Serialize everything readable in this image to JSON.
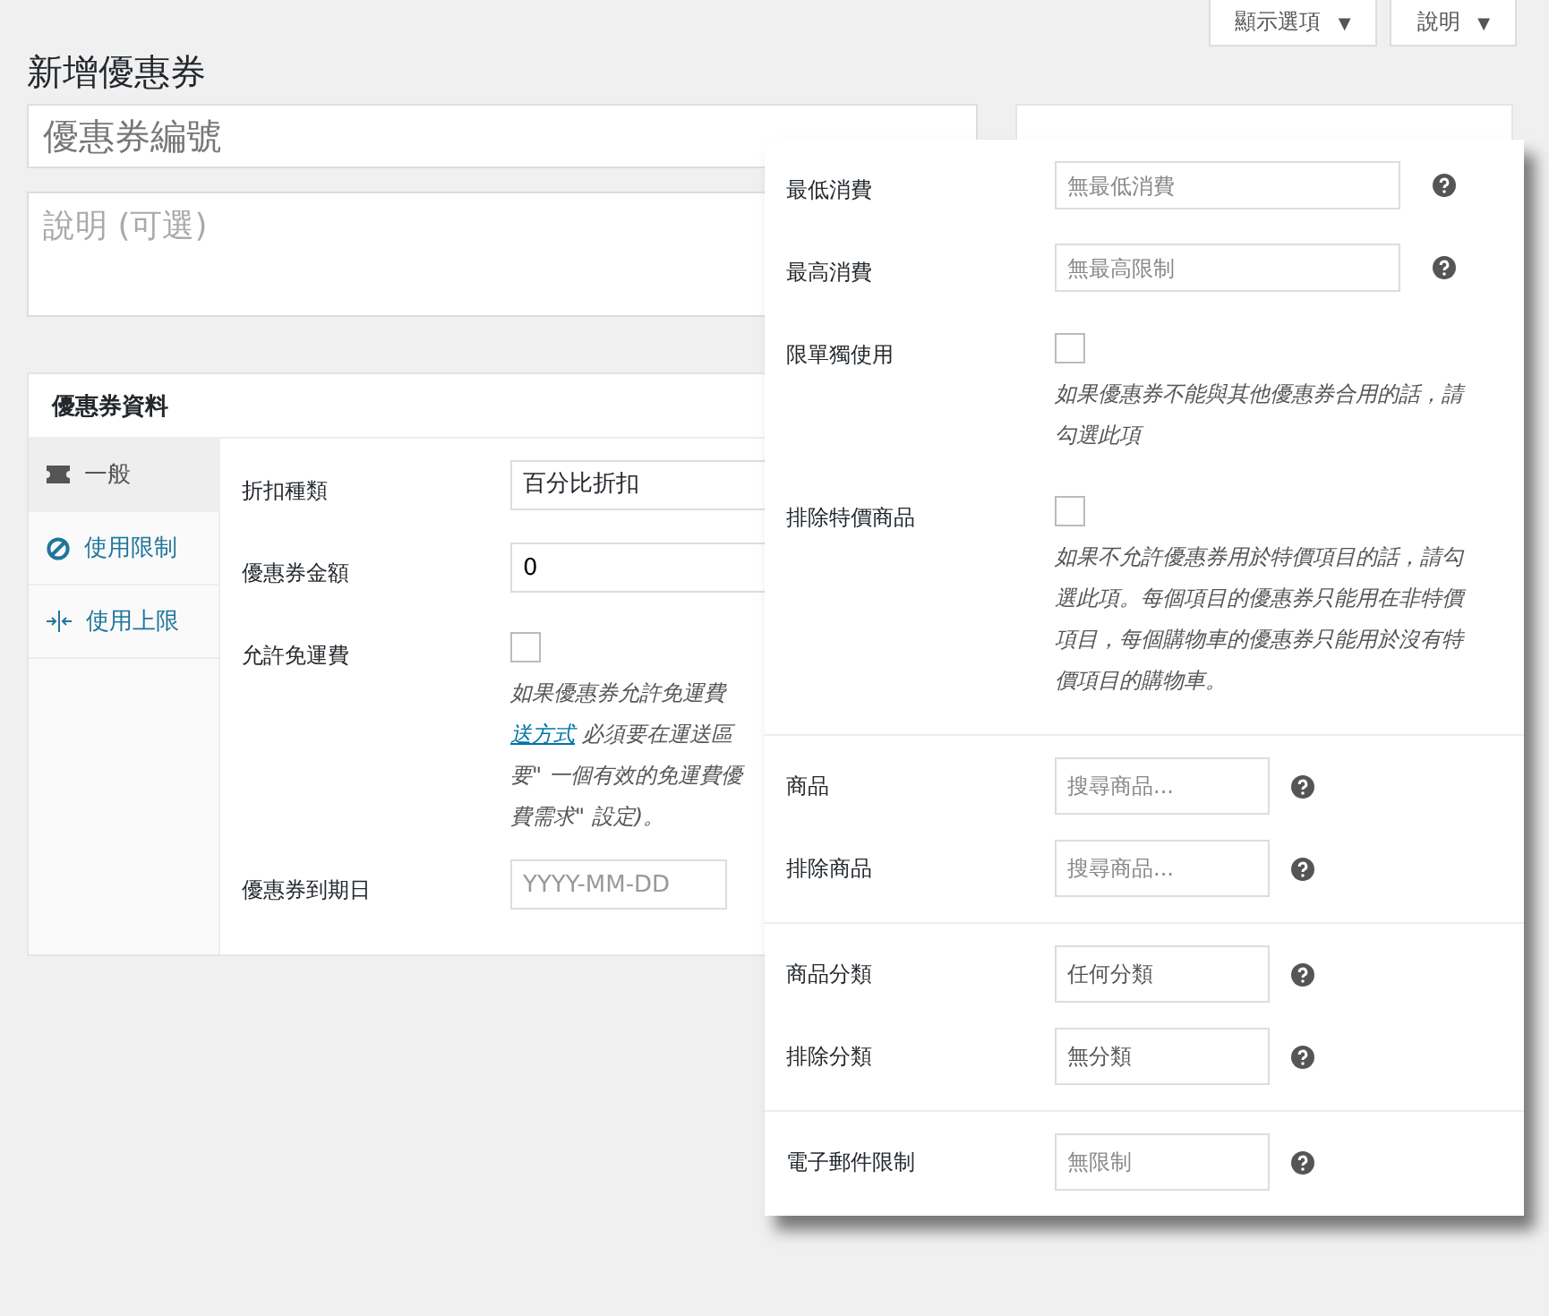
{
  "header_buttons": [
    {
      "label": "顯示選項",
      "caret": "▼"
    },
    {
      "label": "說明",
      "caret": "▼"
    }
  ],
  "page_title": "新增優惠券",
  "coupon_code": {
    "placeholder": "優惠券編號"
  },
  "description": {
    "placeholder": "說明 (可選)"
  },
  "coupon_data": {
    "title": "優惠券資料",
    "tabs": [
      {
        "label": "一般",
        "selected": true
      },
      {
        "label": "使用限制",
        "selected": false
      },
      {
        "label": "使用上限",
        "selected": false
      }
    ],
    "fields": [
      {
        "kind": "select",
        "label": "折扣種類",
        "value": "百分比折扣"
      },
      {
        "kind": "text",
        "label": "優惠券金額",
        "value": "0"
      },
      {
        "kind": "checkbox",
        "label": "允許免運費",
        "checked": false,
        "description_lines": [
          {
            "text": "如果優惠券允許免運費"
          },
          {
            "link": "送方式",
            "text": " 必須要在運送區"
          },
          {
            "text": "要\" 一個有效的免運費優"
          },
          {
            "text": "費需求\" 設定)。"
          }
        ]
      },
      {
        "kind": "text",
        "label": "優惠券到期日",
        "placeholder": "YYYY-MM-DD"
      }
    ]
  },
  "usage_restriction_panel": {
    "sections": [
      {
        "rows": [
          {
            "kind": "text",
            "label": "最低消費",
            "placeholder": "無最低消費"
          },
          {
            "kind": "text",
            "label": "最高消費",
            "placeholder": "無最高限制"
          },
          {
            "kind": "checkbox",
            "label": "限單獨使用",
            "checked": false,
            "description": "如果優惠券不能與其他優惠券合用的話，請勾選此項"
          },
          {
            "kind": "checkbox",
            "label": "排除特價商品",
            "checked": false,
            "description": "如果不允許優惠券用於特價項目的話，請勾選此項。每個項目的優惠券只能用在非特價項目，每個購物車的優惠券只能用於沒有特價項目的購物車。"
          }
        ]
      },
      {
        "rows": [
          {
            "kind": "text",
            "label": "商品",
            "placeholder": "搜尋商品..."
          },
          {
            "kind": "text",
            "label": "排除商品",
            "placeholder": "搜尋商品..."
          }
        ]
      },
      {
        "rows": [
          {
            "kind": "text",
            "label": "商品分類",
            "value": "任何分類"
          },
          {
            "kind": "text",
            "label": "排除分類",
            "value": "無分類"
          }
        ]
      },
      {
        "rows": [
          {
            "kind": "text",
            "label": "電子郵件限制",
            "placeholder": "無限制"
          }
        ]
      }
    ]
  }
}
